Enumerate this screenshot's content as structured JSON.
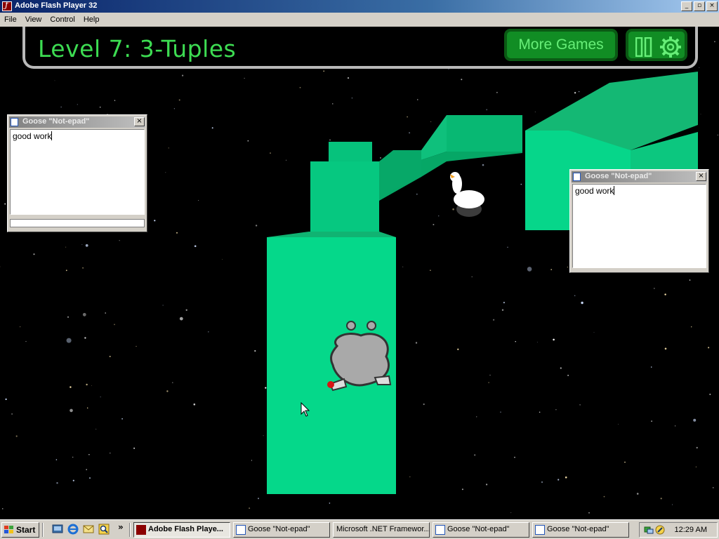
{
  "window": {
    "title": "Adobe Flash Player 32",
    "controls": {
      "minimize": "_",
      "maximize": "▫",
      "close": "×"
    }
  },
  "menu": [
    "File",
    "View",
    "Control",
    "Help"
  ],
  "game": {
    "level_title": "Level 7: 3-Tuples",
    "more_games_label": "More Games",
    "icons": [
      "pause-icon",
      "gear-icon"
    ],
    "colors": {
      "hud_text": "#3ddc52",
      "button_fill": "#118d24",
      "button_text": "#67ee78",
      "block_top": "#1fc07e",
      "block_side": "#05d88a"
    }
  },
  "notepads": [
    {
      "title": "Goose \"Not-epad\"",
      "text": "good work"
    },
    {
      "title": "Goose \"Not-epad\"",
      "text": "good work"
    }
  ],
  "taskbar": {
    "start_label": "Start",
    "overflow": "»",
    "tasks": [
      {
        "label": "Adobe Flash Playe...",
        "active": true
      },
      {
        "label": "Goose \"Not-epad\"",
        "active": false
      },
      {
        "label": "Microsoft .NET Framewor...",
        "active": false
      },
      {
        "label": "Goose \"Not-epad\"",
        "active": false
      },
      {
        "label": "Goose \"Not-epad\"",
        "active": false
      }
    ],
    "clock": "12:29 AM"
  }
}
